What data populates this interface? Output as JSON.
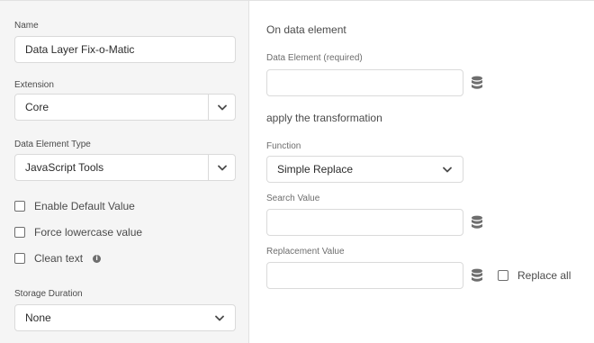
{
  "left": {
    "name_label": "Name",
    "name_value": "Data Layer Fix-o-Matic",
    "extension_label": "Extension",
    "extension_value": "Core",
    "type_label": "Data Element Type",
    "type_value": "JavaScript Tools",
    "options": [
      {
        "label": "Enable Default Value",
        "checked": false
      },
      {
        "label": "Force lowercase value",
        "checked": false
      },
      {
        "label": "Clean text",
        "checked": false
      }
    ],
    "storage_label": "Storage Duration",
    "storage_value": "None"
  },
  "right": {
    "on_heading": "On data element",
    "data_element_label": "Data Element (required)",
    "data_element_value": "",
    "transform_heading": "apply the transformation",
    "function_label": "Function",
    "function_value": "Simple Replace",
    "search_label": "Search Value",
    "search_value": "",
    "replacement_label": "Replacement Value",
    "replacement_value": "",
    "replace_all_label": "Replace all",
    "replace_all_checked": false
  },
  "icons": {
    "chevron": "chevron-down-icon",
    "database": "database-icon",
    "info": "info-icon"
  },
  "colors": {
    "panel_bg": "#f5f5f5",
    "border": "#dadada",
    "text": "#2c2c2c",
    "label": "#6e6e6e",
    "icon": "#6e6e6e"
  }
}
